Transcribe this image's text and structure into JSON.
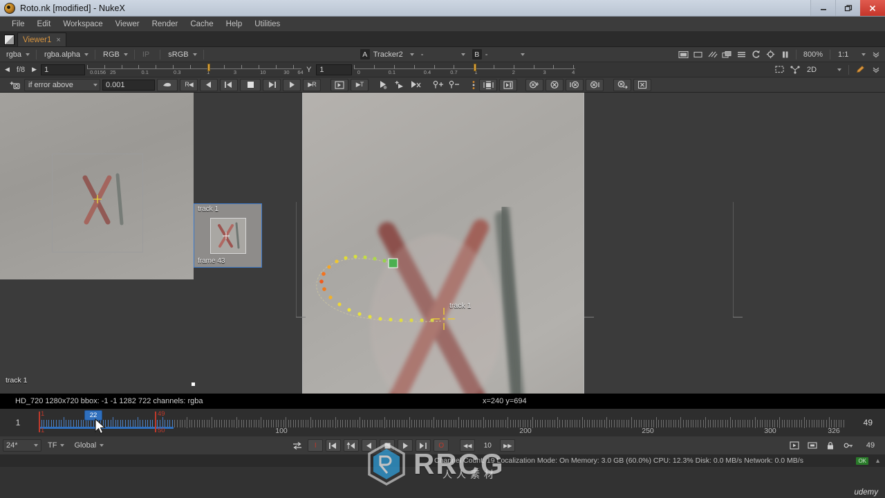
{
  "window": {
    "title": "Roto.nk [modified] - NukeX",
    "app_icon": "nuke-logo-icon",
    "buttons": {
      "minimize": "minimize-icon",
      "restore": "restore-icon",
      "close": "close-icon"
    }
  },
  "menubar": {
    "items": [
      "File",
      "Edit",
      "Workspace",
      "Viewer",
      "Render",
      "Cache",
      "Help",
      "Utilities"
    ]
  },
  "tabs": {
    "items": [
      {
        "label": "Viewer1",
        "close": "×"
      }
    ]
  },
  "viewer_toolbar": {
    "channel_set": "rgba",
    "channel": "rgba.alpha",
    "layer": "RGB",
    "ip_label": "IP",
    "colorspace": "sRGB",
    "input_a_chip": "A",
    "input_a": "Tracker2",
    "operation": "-",
    "input_b_chip": "B",
    "input_b": "-",
    "right_icons": [
      "wipe-icon",
      "roi-icon",
      "proxy-icon",
      "overlay-icon",
      "list-icon",
      "refresh-icon",
      "gain-icon",
      "pause-icon"
    ],
    "zoom": "800%",
    "downrez": "1:1",
    "expand": "chevron-down-icon"
  },
  "gamma_row": {
    "prev_arrow": "◀",
    "fstop": "f/8",
    "next_arrow": "▶",
    "gain_value": "1",
    "gain_ticks": [
      "0.0156",
      "25",
      "0.1",
      "0.3",
      "1",
      "3",
      "10",
      "30",
      "64"
    ],
    "gamma_label": "Y",
    "gamma_value": "1",
    "gamma_ticks": [
      "0",
      "0.1",
      "0.4",
      "0.7",
      "1",
      "2",
      "3",
      "4"
    ],
    "right_icons": [
      "roi-select-icon",
      "node-graph-icon"
    ],
    "view_mode": "2D",
    "pen_icon": "pen-icon",
    "expand_icon": "chevron-down-icon"
  },
  "tracker_toolbar": {
    "add_track_icon": "add-track-icon",
    "keyframe_mode": "if error above",
    "error_threshold": "0.001",
    "buttons": [
      "clear-icon",
      "track-backward-to-start-icon",
      "track-backward-icon",
      "step-back-icon",
      "stop-icon",
      "step-forward-icon",
      "track-forward-icon",
      "track-forward-to-end-icon",
      "keyframe-box-icon",
      "keyframe-t-icon",
      "cut-left-icon",
      "add-key-icon",
      "delete-key-icon",
      "add-user-track-icon",
      "remove-user-track-icon",
      "menu-dots-icon",
      "center-view-icon",
      "show-panel-icon",
      "clear-key-icon",
      "clear-all-keys-icon",
      "clear-back-icon",
      "clear-fwd-icon",
      "clear-sel-icon",
      "hide-icon"
    ]
  },
  "viewer": {
    "thumbnail_panel": {
      "track_label": "track 1",
      "frame_label": "frame 43"
    },
    "left_panel_label": "track 1",
    "track_marker_label": "track 1"
  },
  "status_bar": {
    "format": "HD_720 1280x720  bbox: -1 -1 1282 722 channels: rgba",
    "coords": "x=240 y=694"
  },
  "timeline": {
    "current_frame": "1",
    "in_point": "1",
    "in_point_bottom": "1",
    "out_point": "49",
    "out_point_bottom": "50",
    "playhead_frame": "22",
    "ruler_labels": [
      "100",
      "200",
      "250",
      "300",
      "326"
    ],
    "end_frame": "49",
    "range_end": "326"
  },
  "transport": {
    "fps": "24*",
    "fps_mode": "TF",
    "scope": "Global",
    "sync_icon": "sync-icon",
    "in_icon": "I",
    "first_frame_icon": "first-frame-icon",
    "prev_keyframe_icon": "prev-keyframe-icon",
    "play_back_icon": "play-backward-icon",
    "stop_icon": "stop-icon",
    "play_fwd_icon": "play-forward-icon",
    "next_keyframe_icon": "next-keyframe-icon",
    "out_icon": "O",
    "step_back_icon": "◀◀",
    "increment": "10",
    "step_fwd_icon": "▶▶",
    "right_icons": [
      "play-range-icon",
      "loop-icon",
      "lock-icon",
      "key-icon"
    ],
    "right_frame": "49"
  },
  "footer": {
    "text": "Channel Count: 19  Localization Mode: On  Memory: 3.0 GB (60.0%)  CPU: 12.3%  Disk: 0.0 MB/s Network: 0.0 MB/s",
    "ok_badge": "OK"
  },
  "watermarks": {
    "brand": "RRCG",
    "chinese": "人人素材",
    "course": "udemy"
  },
  "colors": {
    "accent_orange": "#d9953f",
    "selection_blue": "#3b78c8",
    "inout_red": "#c0392b",
    "track_yellow": "#e8e03a",
    "track_green": "#55c84a",
    "panel_bg": "#3a3a3a",
    "titlebar": "#c3ccd9"
  }
}
